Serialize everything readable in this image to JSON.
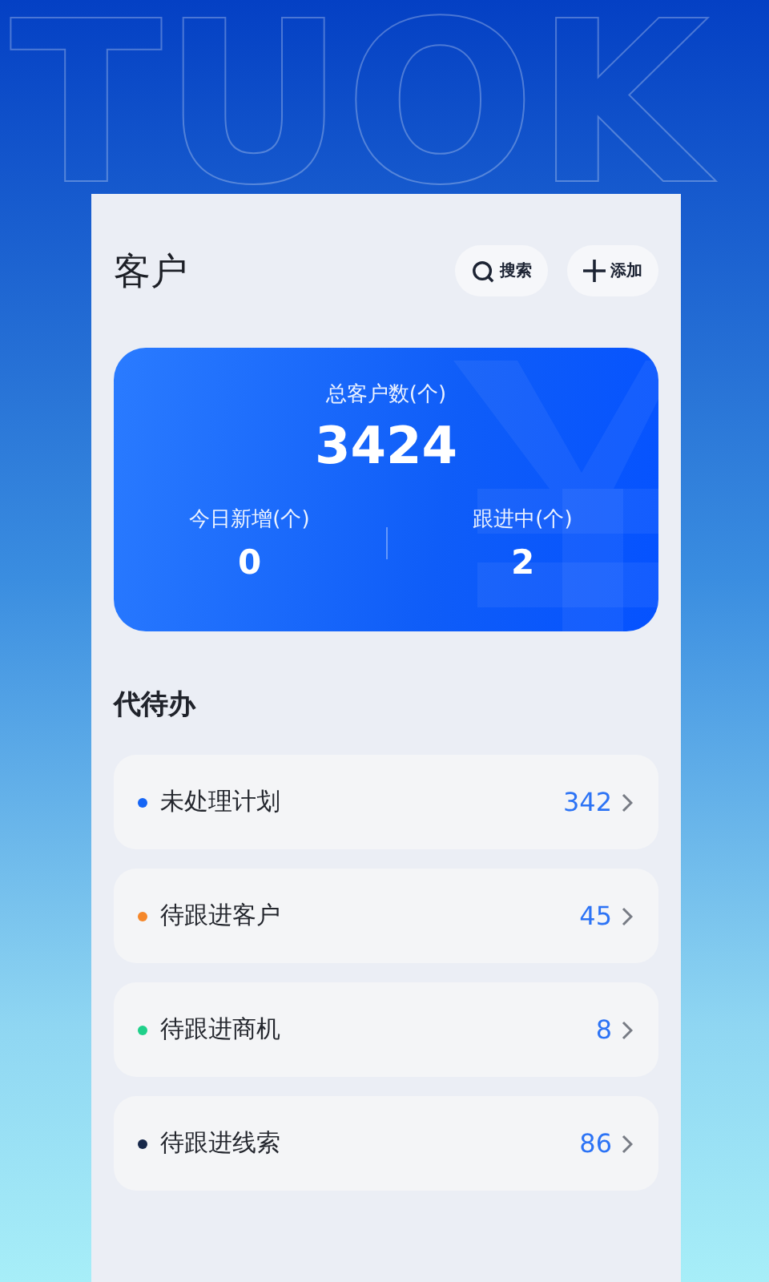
{
  "backdrop_text": "TUOK",
  "page": {
    "title": "客户",
    "actions": [
      {
        "kind": "search",
        "label": "搜索"
      },
      {
        "kind": "add",
        "label": "添加"
      }
    ]
  },
  "summary": {
    "total_label": "总客户数(个)",
    "total_value": "3424",
    "stats": [
      {
        "label": "今日新增(个)",
        "value": "0"
      },
      {
        "label": "跟进中(个)",
        "value": "2"
      }
    ]
  },
  "todo": {
    "title": "代待办",
    "items": [
      {
        "label": "未处理计划",
        "count": "342",
        "color": "#1565f5"
      },
      {
        "label": "待跟进客户",
        "count": "45",
        "color": "#f5872a"
      },
      {
        "label": "待跟进商机",
        "count": "8",
        "color": "#1fd08a"
      },
      {
        "label": "待跟进线索",
        "count": "86",
        "color": "#17284a"
      }
    ]
  }
}
